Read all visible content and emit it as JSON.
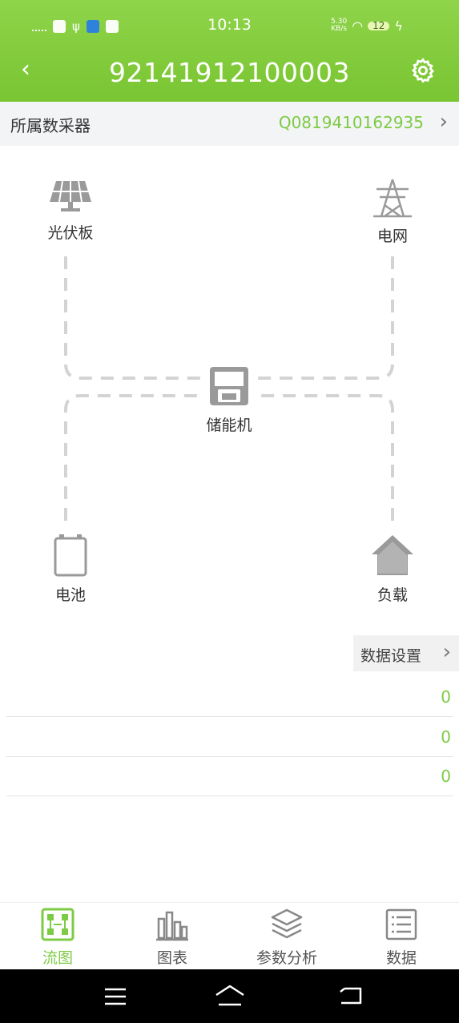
{
  "status_bar": {
    "time": "10:13",
    "speed": "5.30",
    "speed_unit": "KB/s",
    "battery": "12"
  },
  "header": {
    "title": "92141912100003"
  },
  "collector": {
    "label": "所属数采器",
    "value": "Q0819410162935"
  },
  "diagram": {
    "solar": "光伏板",
    "grid": "电网",
    "storage": "储能机",
    "battery": "电池",
    "load": "负载"
  },
  "data_settings": {
    "label": "数据设置"
  },
  "rows": [
    {
      "value": "0"
    },
    {
      "value": "0"
    },
    {
      "value": "0"
    }
  ],
  "tabs": [
    {
      "label": "流图",
      "icon": "flow-icon",
      "active": true
    },
    {
      "label": "图表",
      "icon": "chart-icon",
      "active": false
    },
    {
      "label": "参数分析",
      "icon": "layers-icon",
      "active": false
    },
    {
      "label": "数据",
      "icon": "list-icon",
      "active": false
    }
  ],
  "colors": {
    "primary_green": "#7dcb45",
    "header_green": "#86cf3f"
  }
}
